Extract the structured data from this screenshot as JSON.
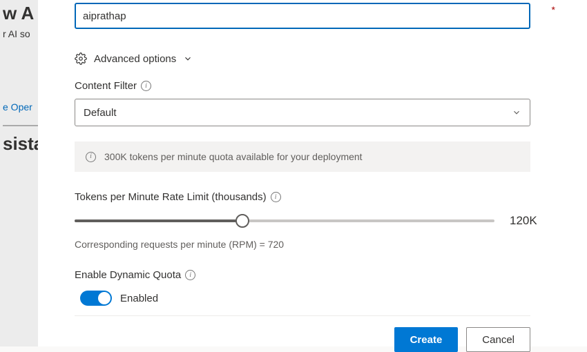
{
  "backdrop": {
    "title_fragment": "w A",
    "subtitle_fragment": "r AI so",
    "link_fragment": "e Oper",
    "heading_fragment": "sista"
  },
  "form": {
    "name_value": "aiprathap",
    "required_mark": "*",
    "advanced_options_label": "Advanced options",
    "content_filter": {
      "label": "Content Filter",
      "selected": "Default"
    },
    "quota_banner": "300K tokens per minute quota available for your deployment",
    "tokens_rate": {
      "label": "Tokens per Minute Rate Limit (thousands)",
      "display_value": "120K",
      "fill_percent": 40
    },
    "rpm_text": "Corresponding requests per minute (RPM) = 720",
    "dynamic_quota": {
      "label": "Enable Dynamic Quota",
      "status": "Enabled"
    }
  },
  "footer": {
    "create_label": "Create",
    "cancel_label": "Cancel"
  }
}
